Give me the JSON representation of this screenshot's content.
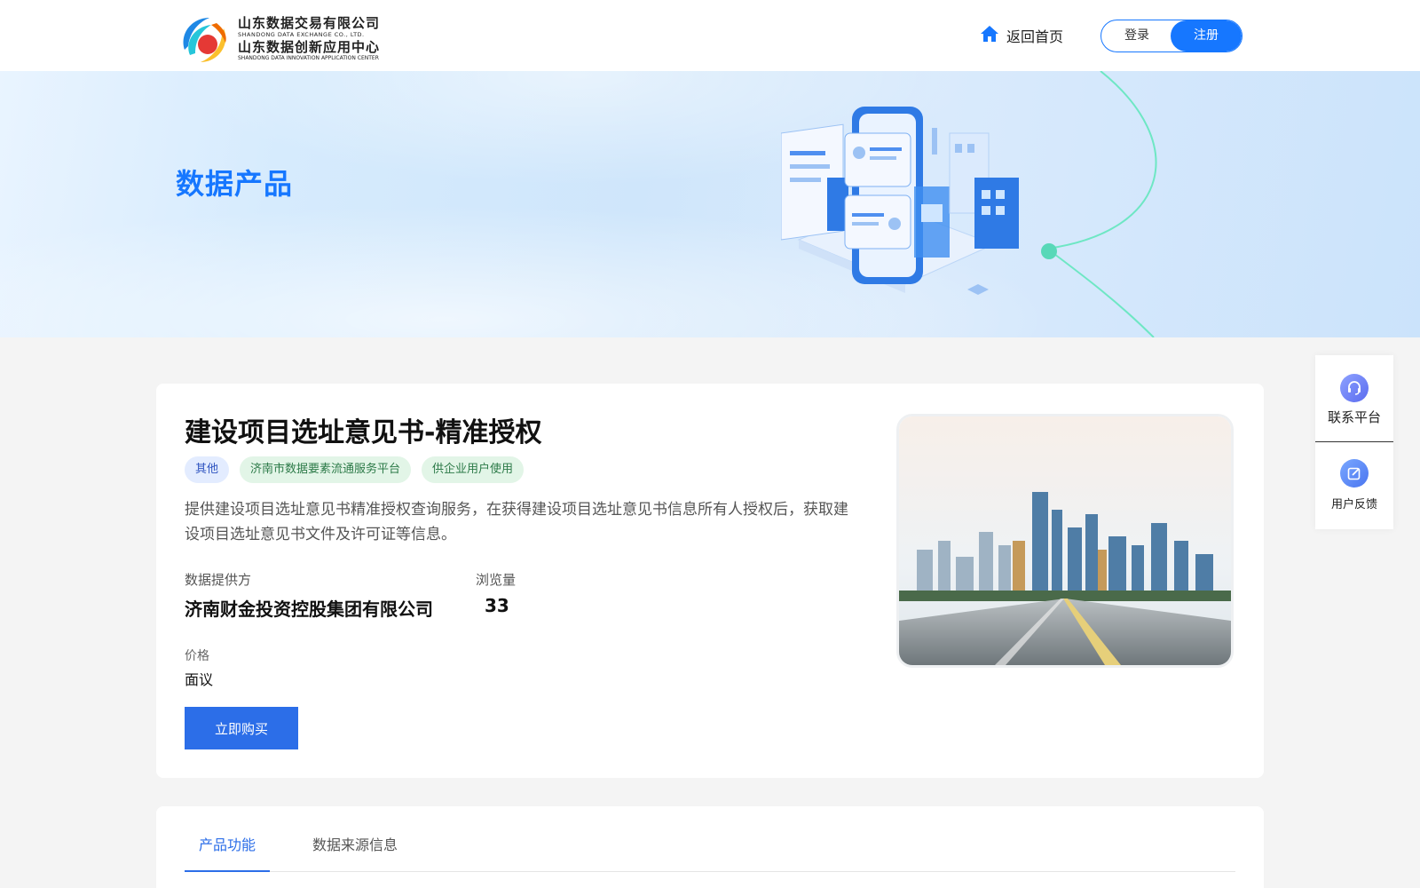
{
  "header": {
    "logo": {
      "name_cn": "山东数据交易有限公司",
      "name_en": "SHANDONG DATA EXCHANGE CO., LTD.",
      "center_cn": "山东数据创新应用中心",
      "center_en": "SHANDONG DATA INNOVATION APPLICATION CENTER"
    },
    "home_label": "返回首页",
    "login_label": "登录",
    "register_label": "注册"
  },
  "banner": {
    "title": "数据产品"
  },
  "product": {
    "title": "建设项目选址意见书-精准授权",
    "tags": [
      {
        "label": "其他",
        "color": "#e3ecff"
      },
      {
        "label": "济南市数据要素流通服务平台",
        "color": "#e2f5e7"
      },
      {
        "label": "供企业用户使用",
        "color": "#e2f5e7"
      }
    ],
    "description": "提供建设项目选址意见书精准授权查询服务，在获得建设项目选址意见书信息所有人授权后，获取建设项目选址意见书文件及许可证等信息。",
    "provider_label": "数据提供方",
    "provider_value": "济南财金投资控股集团有限公司",
    "views_label": "浏览量",
    "views_value": "33",
    "price_label": "价格",
    "price_value": "面议",
    "buy_label": "立即购买"
  },
  "tabs": [
    {
      "label": "产品功能",
      "active": true
    },
    {
      "label": "数据来源信息",
      "active": false
    }
  ],
  "side": {
    "contact_label": "联系平台",
    "feedback_label": "用户反馈"
  },
  "colors": {
    "accent": "#1677ff",
    "button": "#2c6ee8"
  }
}
